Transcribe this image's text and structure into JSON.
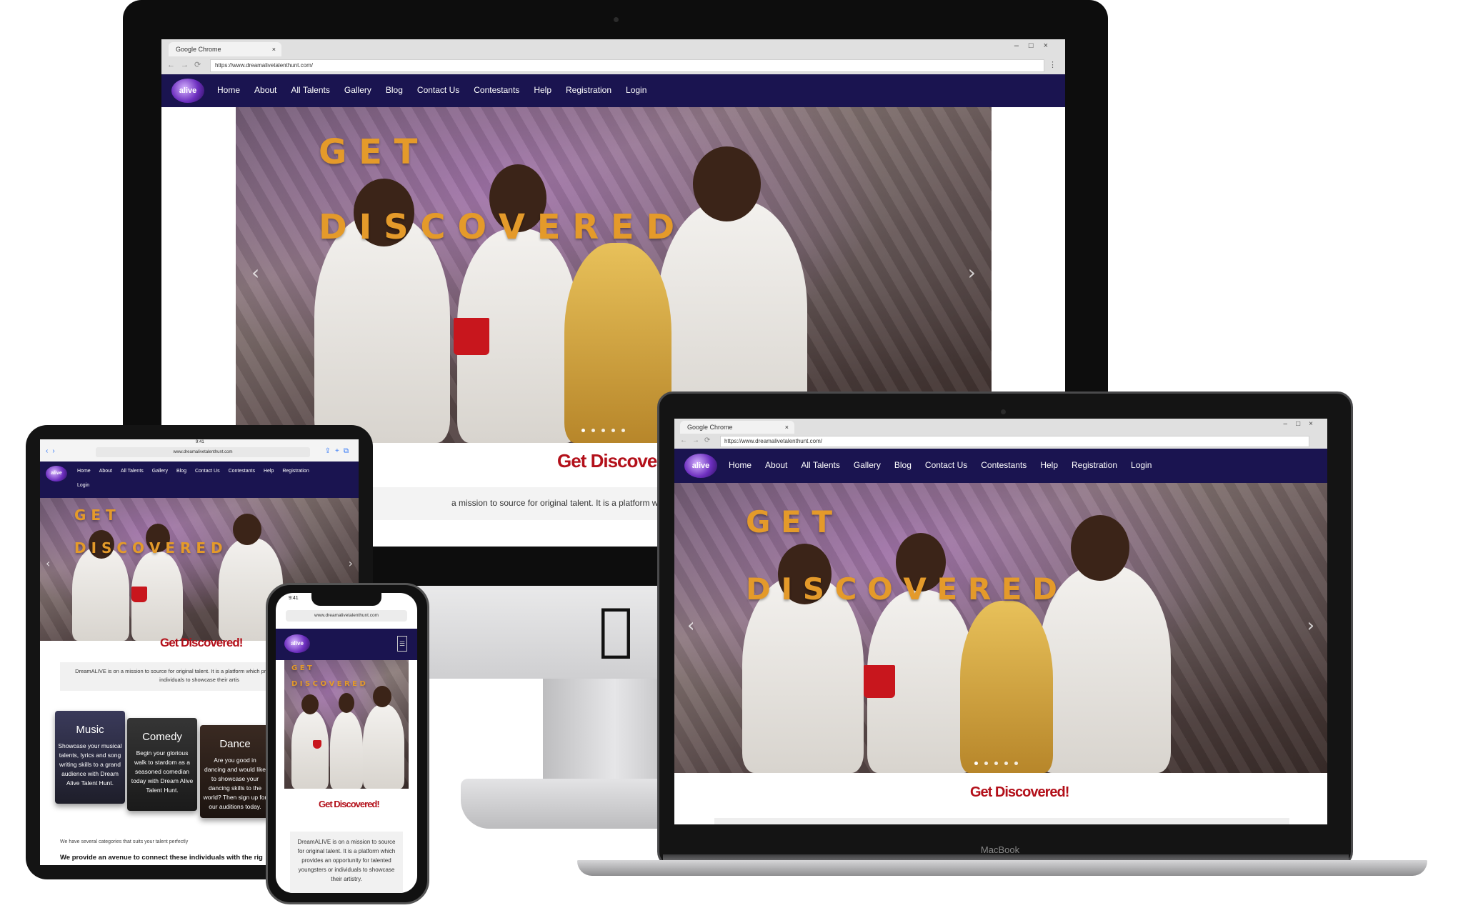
{
  "browser": {
    "tab_title": "Google Chrome",
    "url_desktop": "https://www.dreamalivetalenthunt.com/",
    "url_mobile": "www.dreamalivetalenthunt.com",
    "tablet_time": "9:41",
    "phone_time": "9:41"
  },
  "site": {
    "logo_text": "alive",
    "nav": [
      "Home",
      "About",
      "All Talents",
      "Gallery",
      "Blog",
      "Contact Us",
      "Contestants",
      "Help",
      "Registration",
      "Login"
    ],
    "hero_line1": "G E T",
    "hero_line2": "D I S C O V E R E D",
    "heading": "Get Discovered!",
    "heading_cut": "Get Discovere",
    "mission_desktop": "a mission to source for original talent. It is a platform which provides an opp",
    "mission_tablet": "DreamALIVE is on a mission to source for original talent. It is a platform which pro talented youngsters or individuals to showcase their artis",
    "mission_phone": "DreamALIVE is on a mission to source for original talent. It is a platform which provides an opportunity for talented youngsters or individuals to showcase their artistry.",
    "categories_intro": "We have several categories that suits your talent perfectly",
    "avenue_text": "We provide an avenue to connect these individuals with the rig",
    "cards": [
      {
        "title": "Music",
        "desc": "Showcase your musical talents, lyrics and song writing skills to a grand audience with Dream Alive Talent Hunt."
      },
      {
        "title": "Comedy",
        "desc": "Begin your glorious walk to stardom as a seasoned comedian today with Dream Alive Talent Hunt."
      },
      {
        "title": "Dance",
        "desc": "Are you good in dancing and would like to showcase your dancing skills to the world? Then sign up for our auditions today."
      }
    ]
  },
  "laptop_brand": "MacBook",
  "colors": {
    "navbar": "#1a1450",
    "heading_red": "#b3101a",
    "hero_text": "#e49a2a"
  }
}
